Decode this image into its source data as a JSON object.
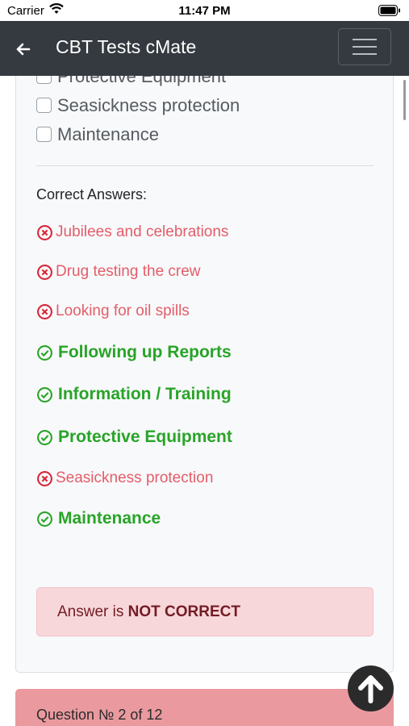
{
  "status_bar": {
    "carrier": "Carrier",
    "time": "11:47 PM"
  },
  "navbar": {
    "title": "CBT Tests cMate"
  },
  "options": [
    {
      "label": "Protective Equipment"
    },
    {
      "label": "Seasickness protection"
    },
    {
      "label": "Maintenance"
    }
  ],
  "answers": {
    "heading": "Correct Answers:",
    "items": [
      {
        "label": "Jubilees and celebrations",
        "correct": false
      },
      {
        "label": "Drug testing the crew",
        "correct": false
      },
      {
        "label": "Looking for oil spills",
        "correct": false
      },
      {
        "label": "Following up Reports",
        "correct": true
      },
      {
        "label": "Information / Training",
        "correct": true
      },
      {
        "label": "Protective Equipment",
        "correct": true
      },
      {
        "label": "Seasickness protection",
        "correct": false
      },
      {
        "label": "Maintenance",
        "correct": true
      }
    ]
  },
  "result": {
    "prefix": "Answer is ",
    "verdict": "NOT CORRECT"
  },
  "next_question": {
    "label": "Question № 2 of 12"
  },
  "colors": {
    "navbar": "#343a40",
    "wrong": "#e35d6a",
    "correct": "#28a428",
    "alert_bg": "#f8d7da",
    "question_bg": "#ea9a9f"
  }
}
